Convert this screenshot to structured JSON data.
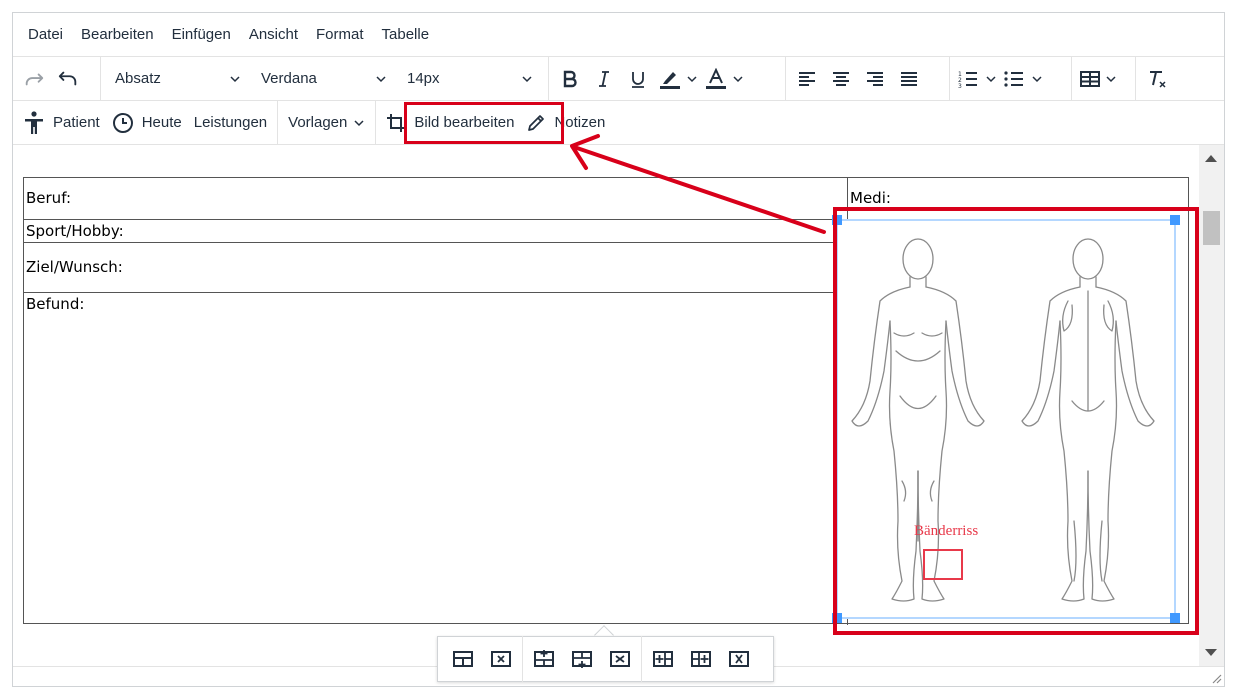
{
  "menubar": {
    "items": [
      "Datei",
      "Bearbeiten",
      "Einfügen",
      "Ansicht",
      "Format",
      "Tabelle"
    ]
  },
  "toolbar": {
    "block_format": "Absatz",
    "font_family": "Verdana",
    "font_size": "14px",
    "icons": [
      "redo-icon",
      "undo-icon",
      "bold-icon",
      "italic-icon",
      "underline-icon",
      "highlight-color-icon",
      "text-color-icon",
      "align-left-icon",
      "align-center-icon",
      "align-right-icon",
      "align-justify-icon",
      "numbered-list-icon",
      "bullet-list-icon",
      "table-icon",
      "clear-formatting-icon"
    ]
  },
  "toolbar2": {
    "patient": "Patient",
    "heute": "Heute",
    "leistungen": "Leistungen",
    "vorlagen": "Vorlagen",
    "bild_bearbeiten": "Bild bearbeiten",
    "notizen": "Notizen"
  },
  "document": {
    "beruf": "Beruf:",
    "sport": "Sport/Hobby:",
    "ziel": "Ziel/Wunsch:",
    "befund": "Befund:",
    "medi": "Medi:",
    "image_annotation": "Bänderriss"
  },
  "annotation": {
    "highlight_color": "#d8001a",
    "selection_color": "#4099ff"
  }
}
